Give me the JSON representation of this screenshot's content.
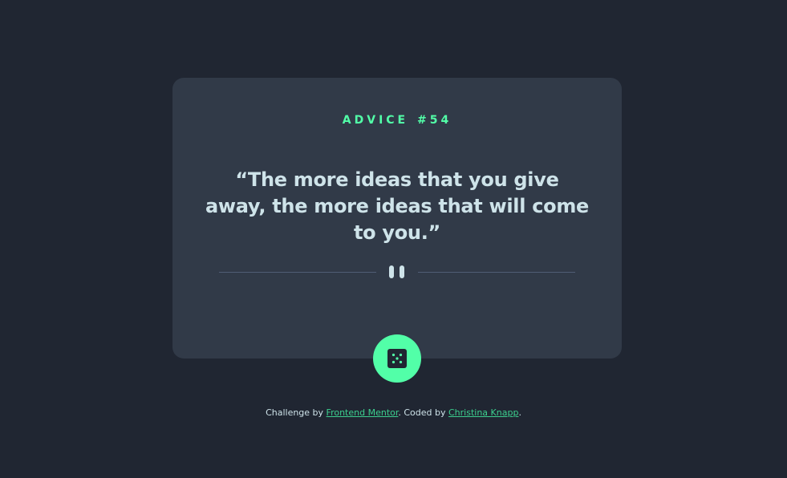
{
  "card": {
    "heading_label": "ADVICE",
    "advice_number": "#54",
    "quote": "“The more ideas that you give away, the more ideas that will come to you.”"
  },
  "divider": {
    "icon": "pause-icon"
  },
  "dice_button": {
    "icon": "dice-icon"
  },
  "footer": {
    "prefix": "Challenge by ",
    "link1": "Frontend Mentor",
    "middle": ". Coded by ",
    "link2": "Christina Knapp",
    "suffix": "."
  },
  "colors": {
    "background": "#202632",
    "card": "#313a48",
    "accent": "#52ffa8",
    "text": "#cee3e9",
    "divider": "#4f5d74"
  }
}
